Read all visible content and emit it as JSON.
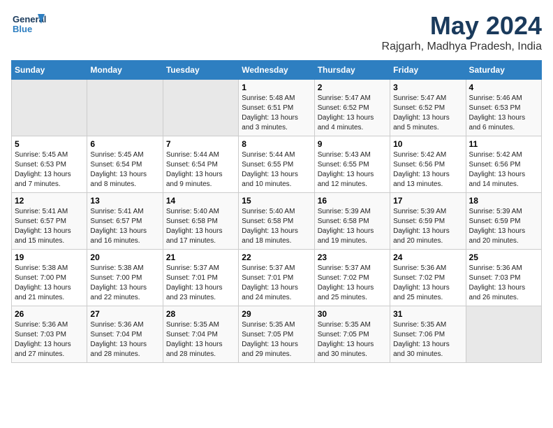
{
  "header": {
    "logo_line1": "General",
    "logo_line2": "Blue",
    "month_title": "May 2024",
    "location": "Rajgarh, Madhya Pradesh, India"
  },
  "weekdays": [
    "Sunday",
    "Monday",
    "Tuesday",
    "Wednesday",
    "Thursday",
    "Friday",
    "Saturday"
  ],
  "weeks": [
    [
      {
        "day": "",
        "info": ""
      },
      {
        "day": "",
        "info": ""
      },
      {
        "day": "",
        "info": ""
      },
      {
        "day": "1",
        "info": "Sunrise: 5:48 AM\nSunset: 6:51 PM\nDaylight: 13 hours and 3 minutes."
      },
      {
        "day": "2",
        "info": "Sunrise: 5:47 AM\nSunset: 6:52 PM\nDaylight: 13 hours and 4 minutes."
      },
      {
        "day": "3",
        "info": "Sunrise: 5:47 AM\nSunset: 6:52 PM\nDaylight: 13 hours and 5 minutes."
      },
      {
        "day": "4",
        "info": "Sunrise: 5:46 AM\nSunset: 6:53 PM\nDaylight: 13 hours and 6 minutes."
      }
    ],
    [
      {
        "day": "5",
        "info": "Sunrise: 5:45 AM\nSunset: 6:53 PM\nDaylight: 13 hours and 7 minutes."
      },
      {
        "day": "6",
        "info": "Sunrise: 5:45 AM\nSunset: 6:54 PM\nDaylight: 13 hours and 8 minutes."
      },
      {
        "day": "7",
        "info": "Sunrise: 5:44 AM\nSunset: 6:54 PM\nDaylight: 13 hours and 9 minutes."
      },
      {
        "day": "8",
        "info": "Sunrise: 5:44 AM\nSunset: 6:55 PM\nDaylight: 13 hours and 10 minutes."
      },
      {
        "day": "9",
        "info": "Sunrise: 5:43 AM\nSunset: 6:55 PM\nDaylight: 13 hours and 12 minutes."
      },
      {
        "day": "10",
        "info": "Sunrise: 5:42 AM\nSunset: 6:56 PM\nDaylight: 13 hours and 13 minutes."
      },
      {
        "day": "11",
        "info": "Sunrise: 5:42 AM\nSunset: 6:56 PM\nDaylight: 13 hours and 14 minutes."
      }
    ],
    [
      {
        "day": "12",
        "info": "Sunrise: 5:41 AM\nSunset: 6:57 PM\nDaylight: 13 hours and 15 minutes."
      },
      {
        "day": "13",
        "info": "Sunrise: 5:41 AM\nSunset: 6:57 PM\nDaylight: 13 hours and 16 minutes."
      },
      {
        "day": "14",
        "info": "Sunrise: 5:40 AM\nSunset: 6:58 PM\nDaylight: 13 hours and 17 minutes."
      },
      {
        "day": "15",
        "info": "Sunrise: 5:40 AM\nSunset: 6:58 PM\nDaylight: 13 hours and 18 minutes."
      },
      {
        "day": "16",
        "info": "Sunrise: 5:39 AM\nSunset: 6:58 PM\nDaylight: 13 hours and 19 minutes."
      },
      {
        "day": "17",
        "info": "Sunrise: 5:39 AM\nSunset: 6:59 PM\nDaylight: 13 hours and 20 minutes."
      },
      {
        "day": "18",
        "info": "Sunrise: 5:39 AM\nSunset: 6:59 PM\nDaylight: 13 hours and 20 minutes."
      }
    ],
    [
      {
        "day": "19",
        "info": "Sunrise: 5:38 AM\nSunset: 7:00 PM\nDaylight: 13 hours and 21 minutes."
      },
      {
        "day": "20",
        "info": "Sunrise: 5:38 AM\nSunset: 7:00 PM\nDaylight: 13 hours and 22 minutes."
      },
      {
        "day": "21",
        "info": "Sunrise: 5:37 AM\nSunset: 7:01 PM\nDaylight: 13 hours and 23 minutes."
      },
      {
        "day": "22",
        "info": "Sunrise: 5:37 AM\nSunset: 7:01 PM\nDaylight: 13 hours and 24 minutes."
      },
      {
        "day": "23",
        "info": "Sunrise: 5:37 AM\nSunset: 7:02 PM\nDaylight: 13 hours and 25 minutes."
      },
      {
        "day": "24",
        "info": "Sunrise: 5:36 AM\nSunset: 7:02 PM\nDaylight: 13 hours and 25 minutes."
      },
      {
        "day": "25",
        "info": "Sunrise: 5:36 AM\nSunset: 7:03 PM\nDaylight: 13 hours and 26 minutes."
      }
    ],
    [
      {
        "day": "26",
        "info": "Sunrise: 5:36 AM\nSunset: 7:03 PM\nDaylight: 13 hours and 27 minutes."
      },
      {
        "day": "27",
        "info": "Sunrise: 5:36 AM\nSunset: 7:04 PM\nDaylight: 13 hours and 28 minutes."
      },
      {
        "day": "28",
        "info": "Sunrise: 5:35 AM\nSunset: 7:04 PM\nDaylight: 13 hours and 28 minutes."
      },
      {
        "day": "29",
        "info": "Sunrise: 5:35 AM\nSunset: 7:05 PM\nDaylight: 13 hours and 29 minutes."
      },
      {
        "day": "30",
        "info": "Sunrise: 5:35 AM\nSunset: 7:05 PM\nDaylight: 13 hours and 30 minutes."
      },
      {
        "day": "31",
        "info": "Sunrise: 5:35 AM\nSunset: 7:06 PM\nDaylight: 13 hours and 30 minutes."
      },
      {
        "day": "",
        "info": ""
      }
    ]
  ]
}
